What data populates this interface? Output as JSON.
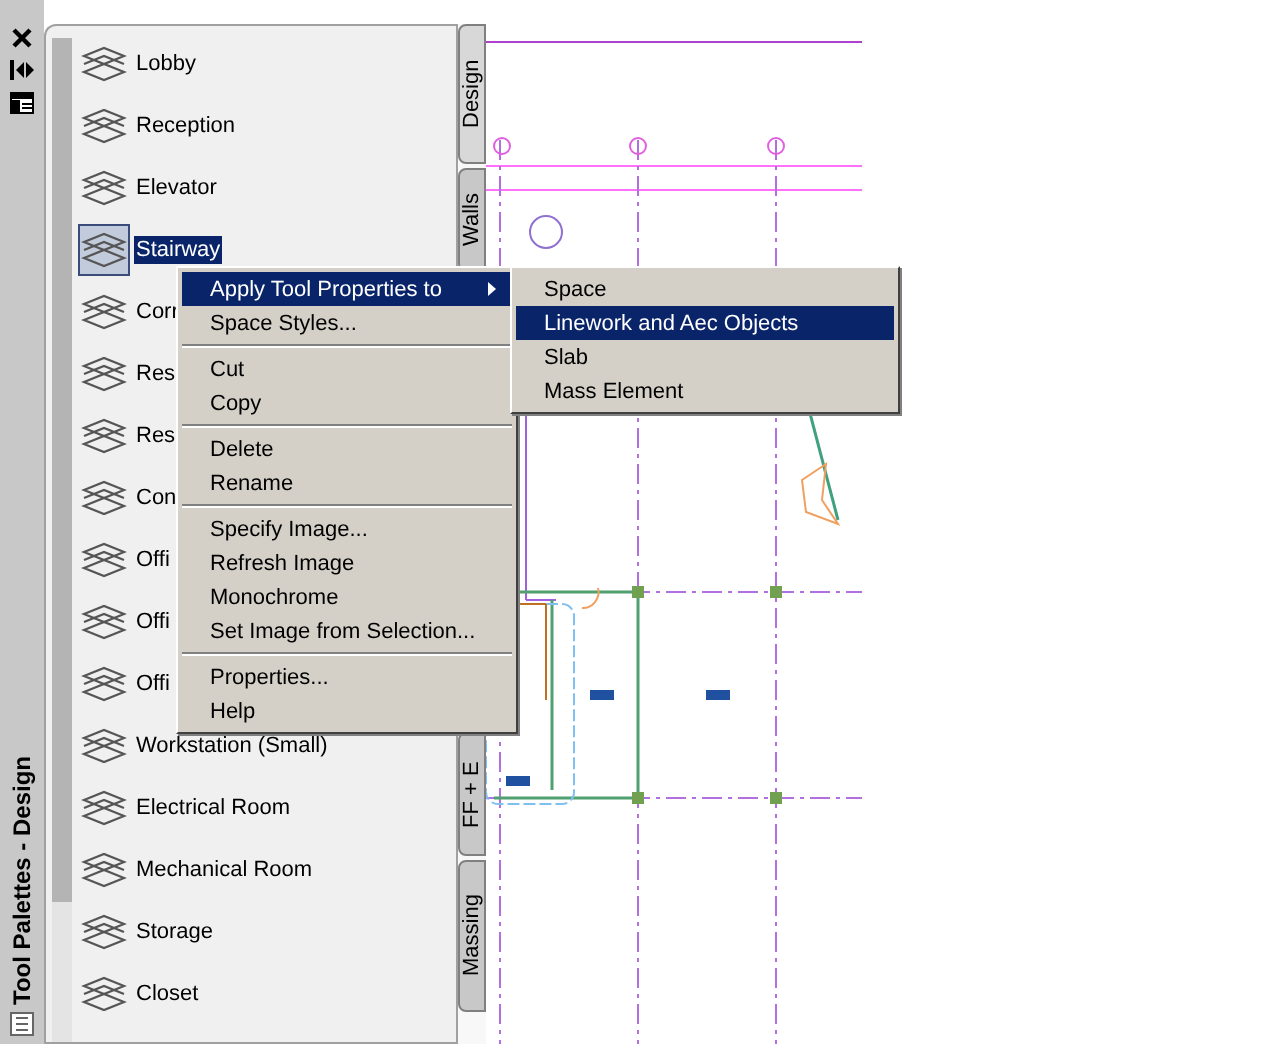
{
  "title_bar": {
    "title": "Tool Palettes - Design"
  },
  "palette": {
    "items": [
      {
        "label": "Lobby",
        "selected": false
      },
      {
        "label": "Reception",
        "selected": false
      },
      {
        "label": "Elevator",
        "selected": false
      },
      {
        "label": "Stairway",
        "selected": true
      },
      {
        "label": "Corr",
        "selected": false
      },
      {
        "label": "Res",
        "selected": false
      },
      {
        "label": "Res",
        "selected": false
      },
      {
        "label": "Con",
        "selected": false
      },
      {
        "label": "Offi",
        "selected": false
      },
      {
        "label": "Offi",
        "selected": false
      },
      {
        "label": "Offi",
        "selected": false
      },
      {
        "label": "Workstation (Small)",
        "selected": false
      },
      {
        "label": "Electrical Room",
        "selected": false
      },
      {
        "label": "Mechanical Room",
        "selected": false
      },
      {
        "label": "Storage",
        "selected": false
      },
      {
        "label": "Closet",
        "selected": false
      }
    ]
  },
  "tabs": [
    {
      "label": "Design",
      "selected": true
    },
    {
      "label": "Walls",
      "selected": false
    },
    {
      "label": "FF + E",
      "selected": false
    },
    {
      "label": "Massing",
      "selected": false
    }
  ],
  "context_menu": {
    "groups": [
      [
        {
          "label": "Apply Tool Properties to",
          "selected": true,
          "has_submenu": true
        },
        {
          "label": "Space Styles...",
          "selected": false,
          "has_submenu": false
        }
      ],
      [
        {
          "label": "Cut",
          "selected": false,
          "has_submenu": false
        },
        {
          "label": "Copy",
          "selected": false,
          "has_submenu": false
        }
      ],
      [
        {
          "label": "Delete",
          "selected": false,
          "has_submenu": false
        },
        {
          "label": "Rename",
          "selected": false,
          "has_submenu": false
        }
      ],
      [
        {
          "label": "Specify Image...",
          "selected": false,
          "has_submenu": false
        },
        {
          "label": "Refresh Image",
          "selected": false,
          "has_submenu": false
        },
        {
          "label": "Monochrome",
          "selected": false,
          "has_submenu": false
        },
        {
          "label": "Set Image from Selection...",
          "selected": false,
          "has_submenu": false
        }
      ],
      [
        {
          "label": "Properties...",
          "selected": false,
          "has_submenu": false
        },
        {
          "label": "Help",
          "selected": false,
          "has_submenu": false
        }
      ]
    ]
  },
  "submenu": {
    "items": [
      {
        "label": "Space",
        "selected": false
      },
      {
        "label": "Linework and Aec Objects",
        "selected": true
      },
      {
        "label": "Slab",
        "selected": false
      },
      {
        "label": "Mass Element",
        "selected": false
      }
    ]
  }
}
